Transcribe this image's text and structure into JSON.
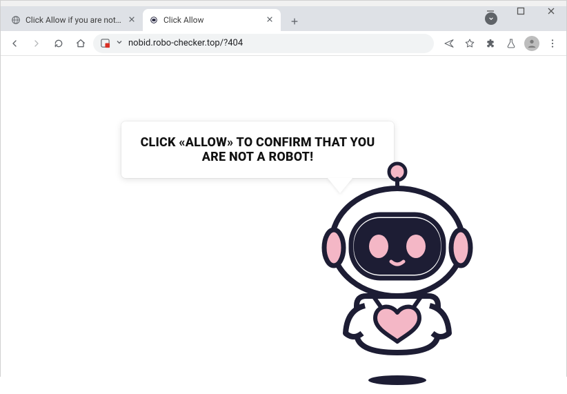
{
  "window": {
    "minimize_tip": "Minimize",
    "maximize_tip": "Maximize",
    "close_tip": "Close"
  },
  "tabs": [
    {
      "title": "Click Allow if you are not a robot",
      "active": false
    },
    {
      "title": "Click Allow",
      "active": true
    }
  ],
  "toolbar": {
    "url": "nobid.robo-checker.top/?404"
  },
  "page": {
    "speech_text": "CLICK «ALLOW» TO CONFIRM THAT YOU ARE NOT A ROBOT!"
  }
}
